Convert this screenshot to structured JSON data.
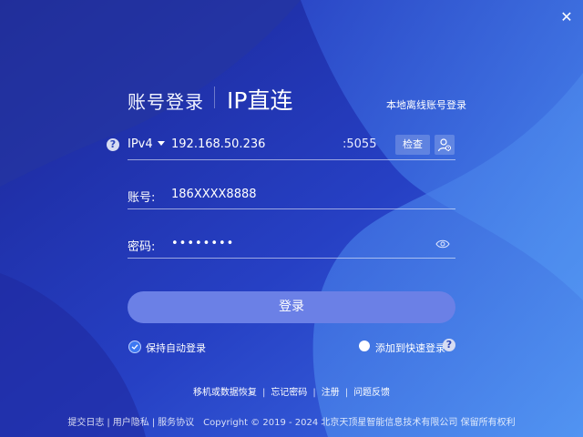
{
  "window": {
    "close_glyph": "✕"
  },
  "tabs": {
    "account_login": "账号登录",
    "ip_direct": "IP直连"
  },
  "offline_login_link": "本地离线账号登录",
  "ip_row": {
    "help_glyph": "?",
    "protocol": "IPv4",
    "ip_value": "192.168.50.236",
    "port": ":5055",
    "check_button": "检查"
  },
  "account": {
    "label": "账号:",
    "value": "186XXXX8888"
  },
  "password": {
    "label": "密码:",
    "value": "••••••••"
  },
  "login_button": "登录",
  "options": {
    "auto_login": "保持自动登录",
    "auto_login_checked": true,
    "add_quick_login": "添加到快速登录",
    "add_quick_login_checked": false,
    "help_glyph": "?"
  },
  "links": [
    "移机或数据恢复",
    "忘记密码",
    "注册",
    "问题反馈"
  ],
  "link_separator": "|",
  "footer": {
    "items": [
      "提交日志",
      "用户隐私",
      "服务协议"
    ],
    "separator": "|",
    "copyright": "Copyright © 2019 - 2024 北京天顶星智能信息技术有限公司 保留所有权利"
  },
  "colors": {
    "bg_dark": "#1f2c9c",
    "bg_mid": "#2f52d0",
    "accent_light": "#4f8bf0",
    "login_button": "#6b80e6",
    "checkbox": "#3d78f2"
  }
}
